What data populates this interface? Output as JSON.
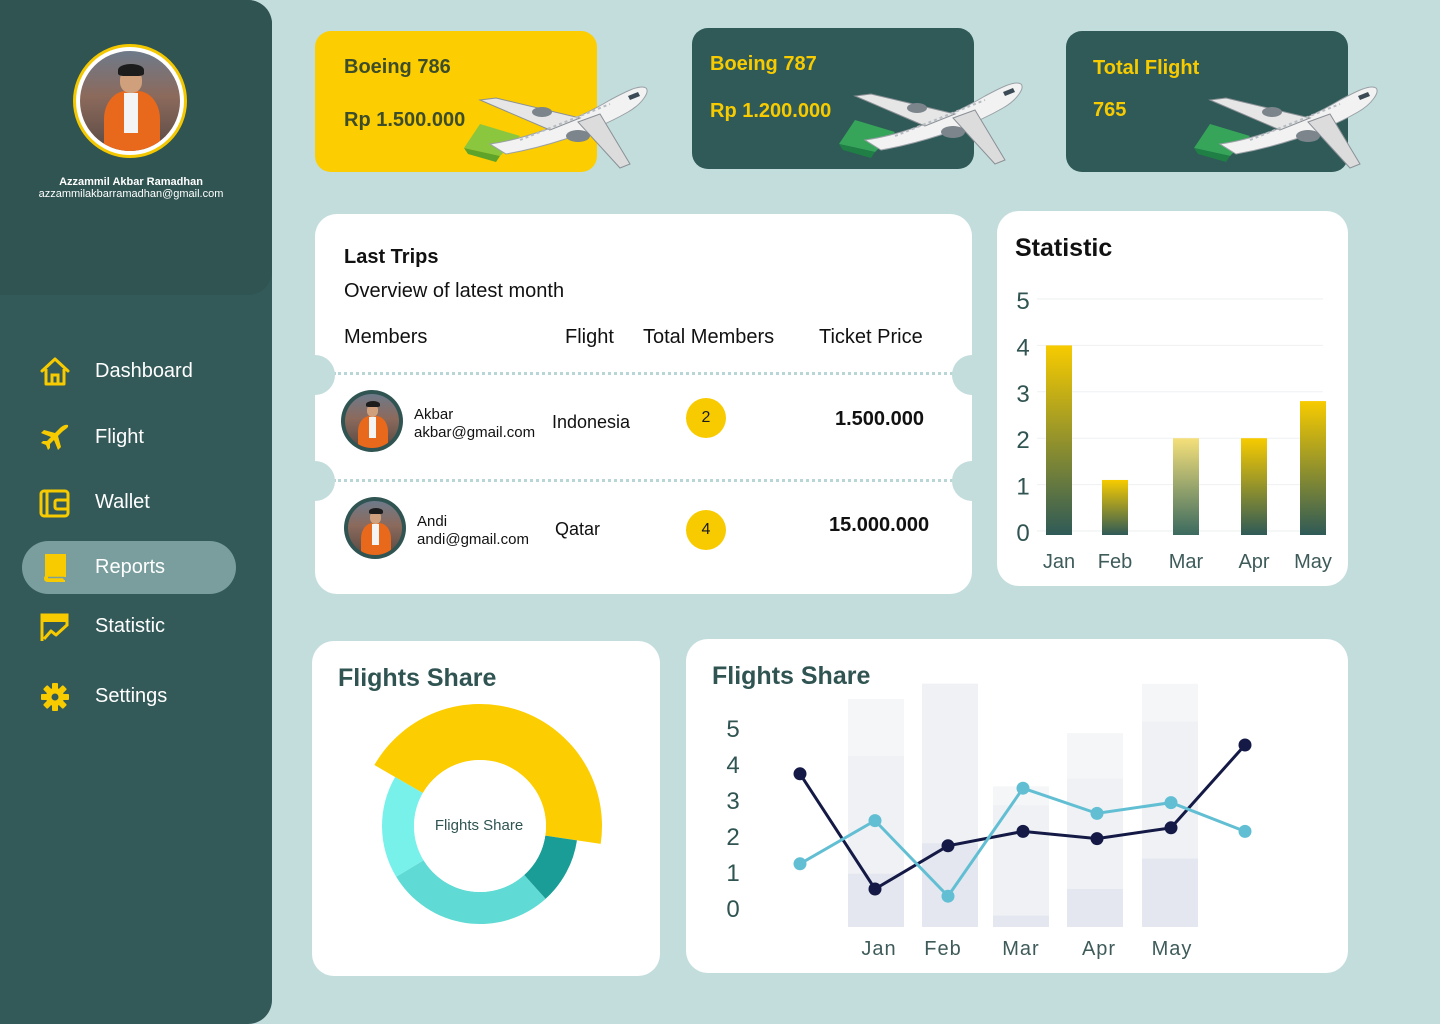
{
  "profile": {
    "name": "Azzammil Akbar Ramadhan",
    "email": "azzammilakbarramadhan@gmail.com"
  },
  "nav": [
    {
      "label": "Dashboard",
      "icon": "home-icon"
    },
    {
      "label": "Flight",
      "icon": "airplane-icon"
    },
    {
      "label": "Wallet",
      "icon": "wallet-icon"
    },
    {
      "label": "Reports",
      "icon": "book-icon",
      "active": true
    },
    {
      "label": "Statistic",
      "icon": "chart-icon"
    },
    {
      "label": "Settings",
      "icon": "gear-icon"
    }
  ],
  "cards": [
    {
      "title": "Boeing 786",
      "value": "Rp 1.500.000"
    },
    {
      "title": "Boeing 787",
      "value": "Rp 1.200.000"
    },
    {
      "title": "Total Flight",
      "value": "765"
    }
  ],
  "trips": {
    "title": "Last Trips",
    "subtitle": "Overview of latest month",
    "columns": [
      "Members",
      "Flight",
      "Total Members",
      "Ticket Price"
    ],
    "rows": [
      {
        "name": "Akbar",
        "email": "akbar@gmail.com",
        "flight": "Indonesia",
        "members": "2",
        "price": "1.500.000"
      },
      {
        "name": "Andi",
        "email": "andi@gmail.com",
        "flight": "Qatar",
        "members": "4",
        "price": "15.000.000"
      }
    ]
  },
  "statistic": {
    "title": "Statistic"
  },
  "donut": {
    "title": "Flights Share",
    "center_label": "Flights Share"
  },
  "line": {
    "title": "Flights Share"
  },
  "colors": {
    "sidebar": "#335a58",
    "accent": "#f7cb00",
    "background": "#c2dddc"
  },
  "chart_data": [
    {
      "type": "bar",
      "title": "Statistic",
      "categories": [
        "Jan",
        "Feb",
        "Mar",
        "Apr",
        "May"
      ],
      "values": [
        4,
        1.1,
        2,
        2,
        2.8
      ],
      "ylim": [
        0,
        5
      ],
      "yticks": [
        0,
        1,
        2,
        3,
        4,
        5
      ],
      "grid": true
    },
    {
      "type": "pie",
      "title": "Flights Share",
      "values": [
        44,
        11,
        28,
        17
      ],
      "colors": [
        "#fccd00",
        "#1a9d96",
        "#5fdad4",
        "#78f1eb"
      ],
      "center_label": "Flights Share"
    },
    {
      "type": "line",
      "title": "Flights Share",
      "categories": [
        "Jan",
        "Feb",
        "Mar",
        "Apr",
        "May"
      ],
      "ylim": [
        0,
        5
      ],
      "yticks": [
        0,
        1,
        2,
        3,
        4,
        5
      ],
      "series": [
        {
          "values": [
            3.7,
            0.5,
            1.7,
            2.1,
            1.9,
            2.2,
            4.5
          ],
          "color": "#141a45"
        },
        {
          "values": [
            1.2,
            2.4,
            0.3,
            3.3,
            2.6,
            2.9,
            2.1
          ],
          "color": "#62bfd3"
        }
      ],
      "background_bars": [
        {
          "total": 6,
          "segments": [
            1.4,
            4.5
          ]
        },
        {
          "total": 6.4,
          "segments": [
            2.2,
            6.4
          ]
        },
        {
          "total": 3.7,
          "segments": [
            0.3,
            3.2
          ]
        },
        {
          "total": 5.1,
          "segments": [
            1.0,
            3.9
          ]
        },
        {
          "total": 6.4,
          "segments": [
            1.8,
            5.4
          ]
        }
      ]
    }
  ]
}
